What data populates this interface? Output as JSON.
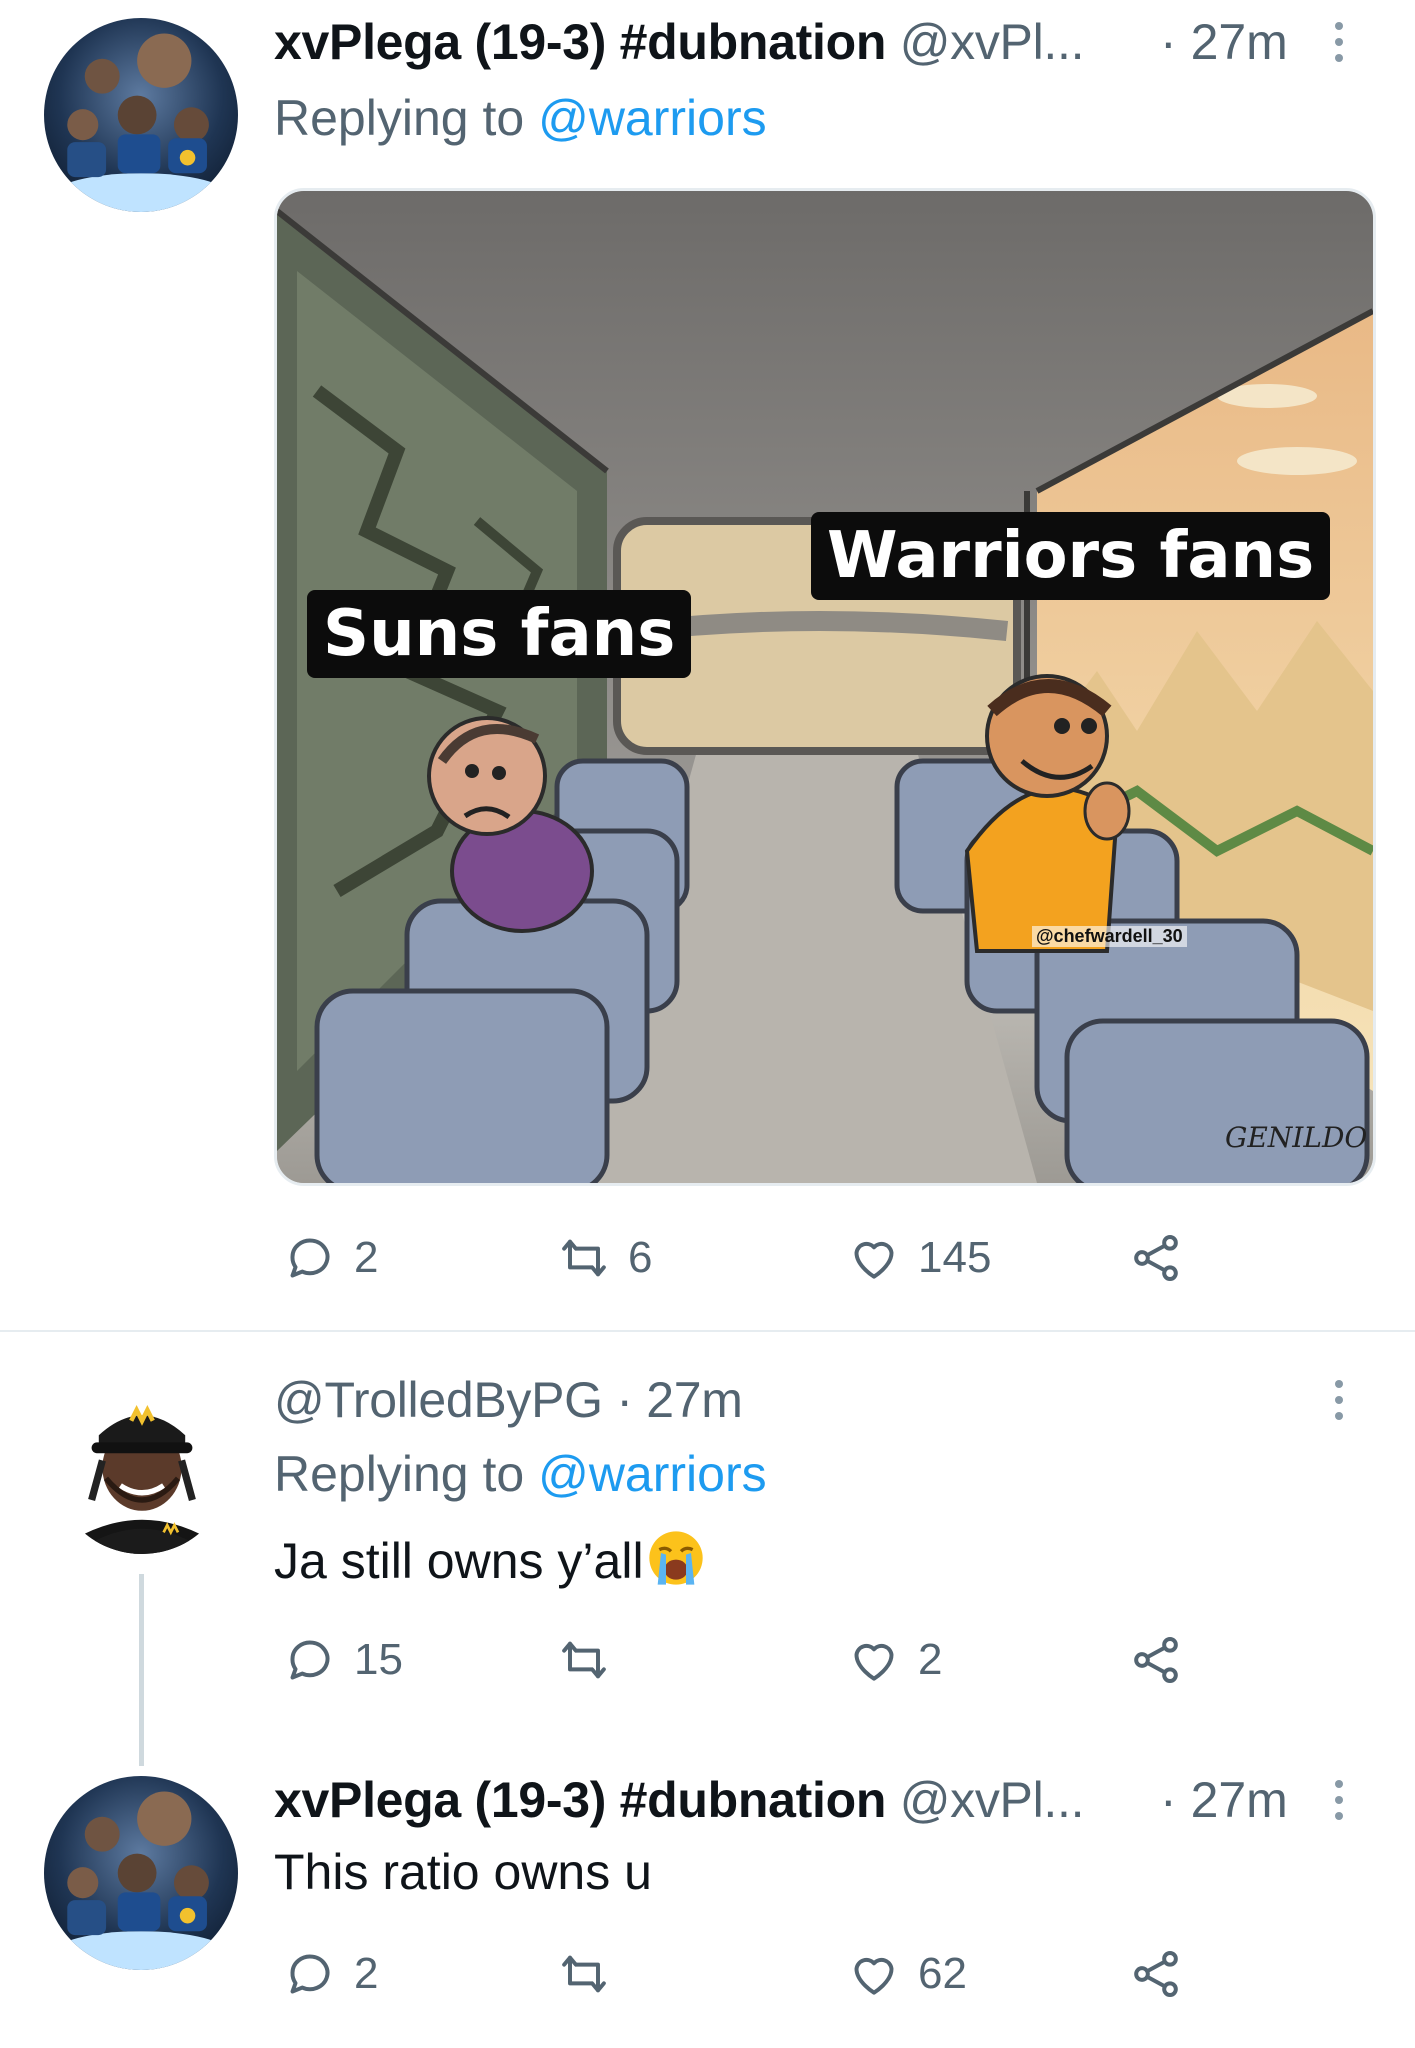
{
  "tweet1": {
    "display_name": "xvPlega (19-3) #dubnation",
    "handle": "@xvPl...",
    "separator": "·",
    "time": "27m",
    "replying_prefix": "Replying to",
    "replying_to": "@warriors",
    "media": {
      "label_left": "Suns fans",
      "label_right": "Warriors fans",
      "watermark": "@chefwardell_30",
      "signature": "GENILDO"
    },
    "replies": "2",
    "retweets": "6",
    "likes": "145"
  },
  "tweet2": {
    "handle": "@TrolledByPG",
    "separator": "·",
    "time": "27m",
    "replying_prefix": "Replying to",
    "replying_to": "@warriors",
    "text": "Ja still owns y’all",
    "emoji": "loudly-crying-face",
    "replies": "15",
    "likes": "2"
  },
  "tweet3": {
    "display_name": "xvPlega (19-3) #dubnation",
    "handle": "@xvPl...",
    "separator": "·",
    "time": "27m",
    "text": "This ratio owns u",
    "replies": "2",
    "likes": "62"
  },
  "colors": {
    "link": "#1d9bf0",
    "secondary_text": "#536471",
    "divider": "#e6ecf0"
  }
}
